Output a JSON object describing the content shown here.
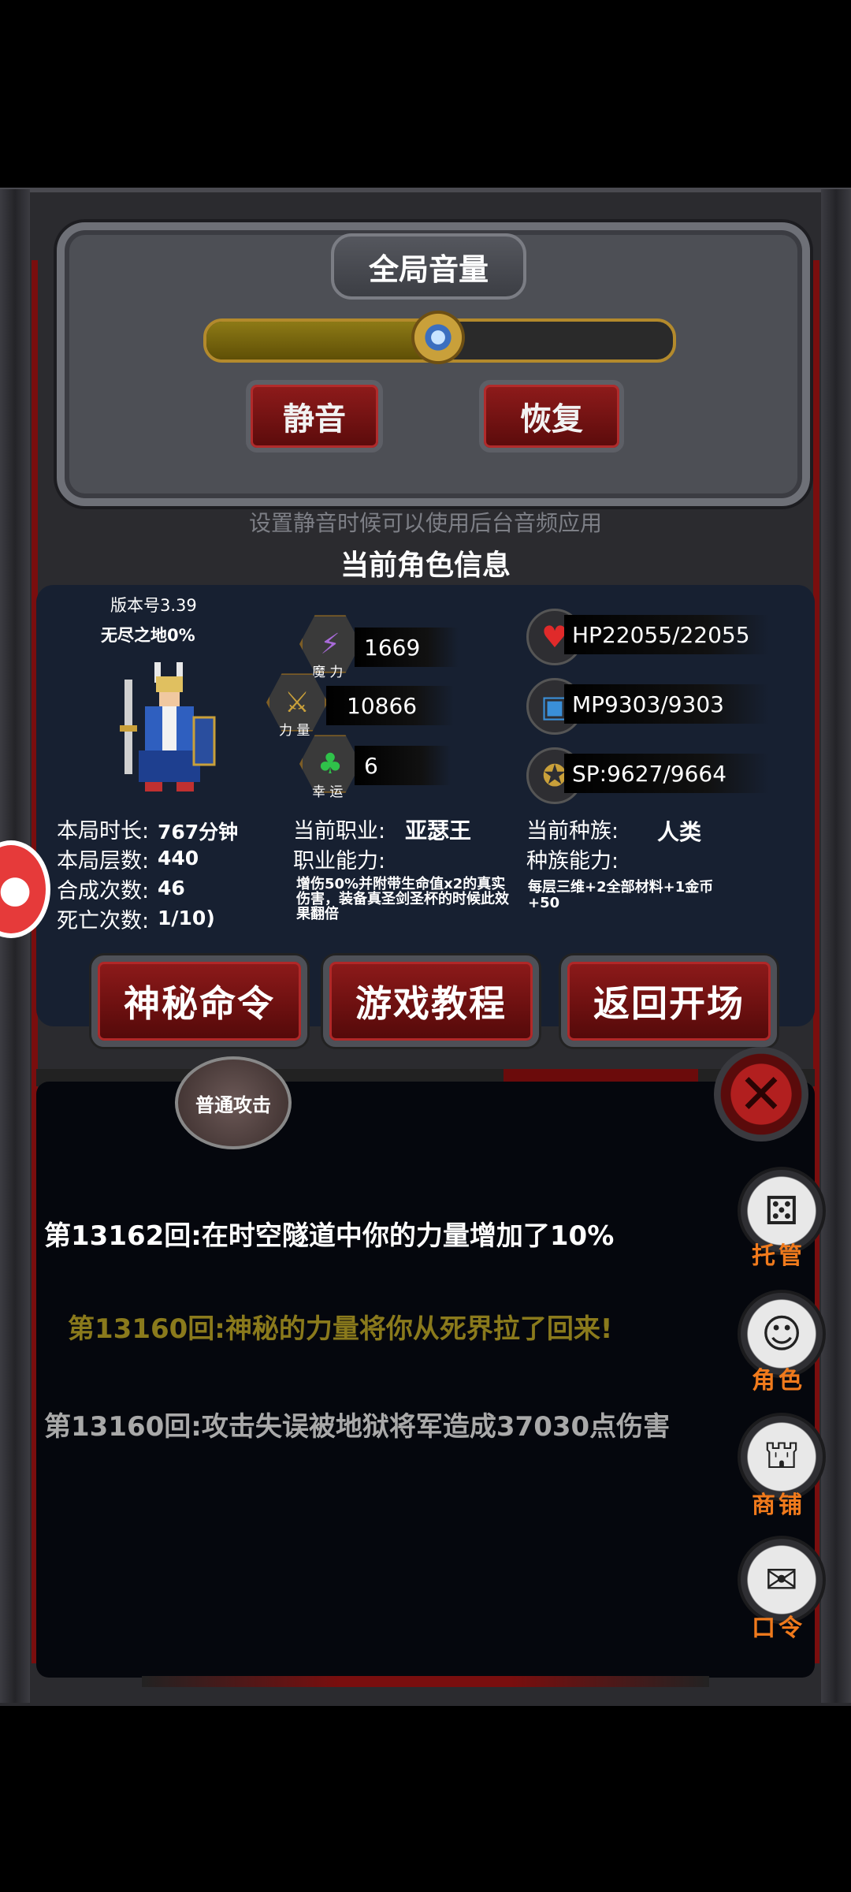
{
  "volume": {
    "title": "全局音量",
    "level": 0.5,
    "mute_label": "静音",
    "restore_label": "恢复",
    "hint": "设置静音时候可以使用后台音频应用"
  },
  "character": {
    "section_title": "当前角色信息",
    "version": "版本号3.39",
    "mode": "无尽之地0%",
    "stats": {
      "magic": {
        "value": "1669",
        "caption": "魔 力",
        "icon": "lightning-icon"
      },
      "power": {
        "value": "10866",
        "caption": "力 量",
        "icon": "sword-icon"
      },
      "luck": {
        "value": "6",
        "caption": "幸 运",
        "icon": "clover-icon"
      }
    },
    "vitals": {
      "hp": "HP22055/22055",
      "mp": "MP9303/9303",
      "sp": "SP:9627/9664"
    },
    "session": {
      "time_label": "本局时长:",
      "time_value": "767分钟",
      "floors_label": "本局层数:",
      "floors_value": "440",
      "merge_label": "合成次数:",
      "merge_value": "46",
      "death_label": "死亡次数:",
      "death_value": "1/10)"
    },
    "job": {
      "label": "当前职业:",
      "value": "亚瑟王",
      "ability_label": "职业能力:",
      "ability_text": "增伤50%并附带生命值x2的真实伤害，装备真圣剑圣杯的时候此效果翻倍"
    },
    "race": {
      "label": "当前种族:",
      "value": "人类",
      "ability_label": "种族能力:",
      "ability_text": "每层三维+2全部材料+1金币+50"
    }
  },
  "actions": {
    "secret_command": "神秘命令",
    "tutorial": "游戏教程",
    "return_start": "返回开场"
  },
  "attack_button": "普通攻击",
  "log": [
    {
      "text": "第13162回:在时空隧道中你的力量增加了10%",
      "color": "#ffffff"
    },
    {
      "text": "第13160回:神秘的力量将你从死界拉了回来!",
      "color": "#8a7a1c"
    },
    {
      "text": "第13160回:攻击失误被地狱将军造成37030点伤害",
      "color": "#a9a9a9"
    }
  ],
  "side_menu": [
    {
      "label": "托管",
      "icon": "dice-icon"
    },
    {
      "label": "角色",
      "icon": "hooded-figure-icon"
    },
    {
      "label": "商铺",
      "icon": "shop-sign-icon"
    },
    {
      "label": "口令",
      "icon": "scroll-icon"
    }
  ],
  "colors": {
    "accent_red": "#8e1a1a",
    "gold": "#b38a2c",
    "menu_label": "#f07a1c"
  }
}
